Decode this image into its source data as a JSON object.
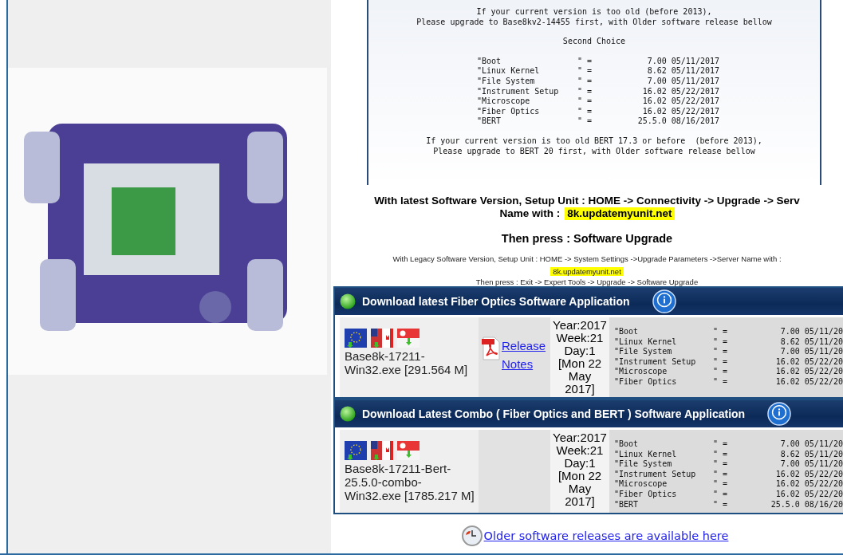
{
  "top_notice": {
    "lines_before": [
      "If your current version is too old (before 2013),",
      "Please upgrade to Base8kv2-14455 first, with Older software release bellow"
    ],
    "subheading": "Second Choice",
    "versions": [
      {
        "name": "\"Boot",
        "eq": "\" =",
        "value": "7.00 05/11/2017"
      },
      {
        "name": "\"Linux Kernel",
        "eq": "\" =",
        "value": "8.62 05/11/2017"
      },
      {
        "name": "\"File System",
        "eq": "\" =",
        "value": "7.00 05/11/2017"
      },
      {
        "name": "\"Instrument Setup",
        "eq": "\" =",
        "value": "16.02 05/22/2017"
      },
      {
        "name": "\"Microscope",
        "eq": "\" =",
        "value": "16.02 05/22/2017"
      },
      {
        "name": "\"Fiber Optics",
        "eq": "\" =",
        "value": "16.02 05/22/2017"
      },
      {
        "name": "\"BERT",
        "eq": "\" =",
        "value": "25.5.0 08/16/2017"
      }
    ],
    "lines_after": [
      "If your current version is too old BERT 17.3 or before  (before 2013),",
      "Please upgrade to BERT 20 first, with Older software release bellow"
    ]
  },
  "instructions": {
    "latest_line": "With latest Software Version, Setup Unit : HOME -> Connectivity -> Upgrade -> Serv",
    "latest_name_label": "Name with :",
    "server": "8k.updatemyunit.net",
    "then_press": "Then press : Software Upgrade",
    "legacy_line": "With Legacy Software Version, Setup Unit : HOME -> System Settings ->Upgrade Parameters ->Server Name with :",
    "legacy_server": "8k.updatemyunit.net",
    "legacy_then": "Then press : Exit -> Expert Tools -> Upgrade -> Software Upgrade"
  },
  "downloads": [
    {
      "title": "Download latest Fiber Optics Software Application",
      "file": "Base8k-17211-Win32.exe [291.564 M]",
      "release_notes": "Release Notes",
      "date": "Year:2017 Week:21 Day:1 [Mon 22 May 2017]",
      "versions": [
        {
          "name": "\"Boot",
          "eq": "\" =",
          "value": "7.00 05/11/20"
        },
        {
          "name": "\"Linux Kernel",
          "eq": "\" =",
          "value": "8.62 05/11/20"
        },
        {
          "name": "\"File System",
          "eq": "\" =",
          "value": "7.00 05/11/20"
        },
        {
          "name": "\"Instrument Setup",
          "eq": "\" =",
          "value": "16.02 05/22/20"
        },
        {
          "name": "\"Microscope",
          "eq": "\" =",
          "value": "16.02 05/22/20"
        },
        {
          "name": "\"Fiber Optics",
          "eq": "\" =",
          "value": "16.02 05/22/20"
        }
      ]
    },
    {
      "title": "Download Latest Combo ( Fiber Optics and BERT ) Software Application",
      "file": "Base8k-17211-Bert-25.5.0-combo-Win32.exe [1785.217 M]",
      "date": "Year:2017 Week:21 Day:1 [Mon 22 May 2017]",
      "versions": [
        {
          "name": "\"Boot",
          "eq": "\" =",
          "value": "7.00 05/11/20"
        },
        {
          "name": "\"Linux Kernel",
          "eq": "\" =",
          "value": "8.62 05/11/20"
        },
        {
          "name": "\"File System",
          "eq": "\" =",
          "value": "7.00 05/11/20"
        },
        {
          "name": "\"Instrument Setup",
          "eq": "\" =",
          "value": "16.02 05/22/20"
        },
        {
          "name": "\"Microscope",
          "eq": "\" =",
          "value": "16.02 05/22/20"
        },
        {
          "name": "\"Fiber Optics",
          "eq": "\" =",
          "value": "16.02 05/22/20"
        },
        {
          "name": "\"BERT",
          "eq": "\" =",
          "value": "25.5.0 08/16/20"
        }
      ]
    }
  ],
  "older_link": "Older software releases are available here"
}
